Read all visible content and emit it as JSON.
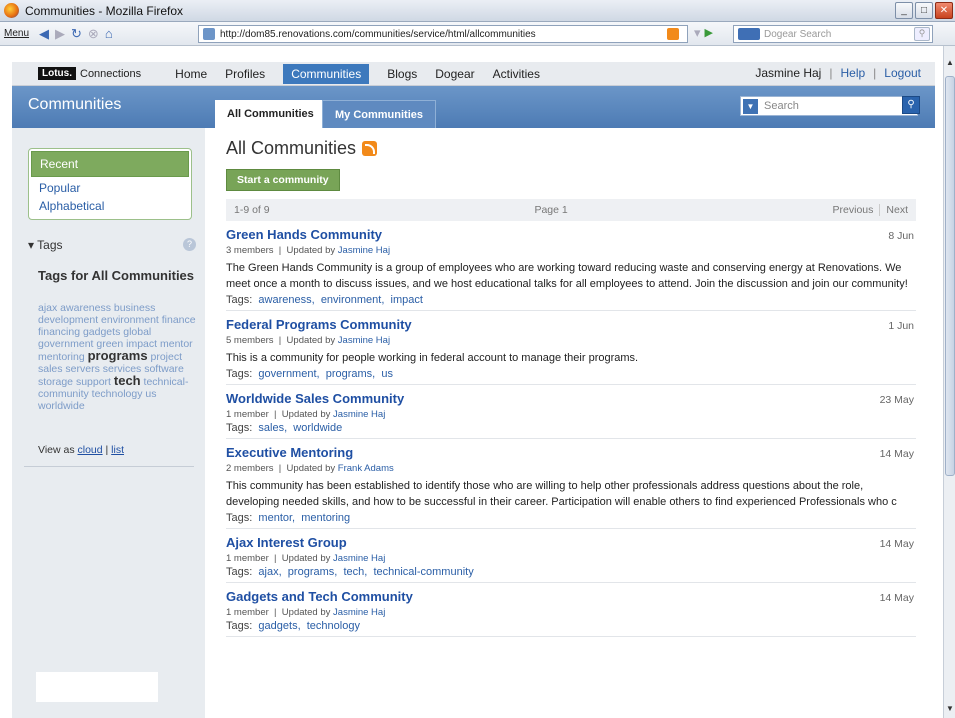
{
  "window": {
    "title": "Communities - Mozilla Firefox"
  },
  "browser": {
    "menu_label": "Menu",
    "url": "http://dom85.renovations.com/communities/service/html/allcommunities",
    "search_placeholder": "Dogear Search"
  },
  "app": {
    "logo_brand": "Lotus.",
    "logo_product": "Connections",
    "nav": [
      "Home",
      "Profiles",
      "Communities",
      "Blogs",
      "Dogear",
      "Activities"
    ],
    "user": "Jasmine Haj",
    "help": "Help",
    "logout": "Logout"
  },
  "header": {
    "page_title": "Communities",
    "tabs": [
      "All Communities",
      "My Communities"
    ],
    "search_placeholder": "Search"
  },
  "sidebar": {
    "filters": [
      "Recent",
      "Popular",
      "Alphabetical"
    ],
    "tags_heading": "Tags",
    "tags_all_heading": "Tags for All Communities",
    "tag_cloud_before": "ajax awareness business development environment finance financing gadgets global government green impact mentor mentoring ",
    "tag_big_1": "programs",
    "tag_cloud_mid": " project sales servers services software storage support ",
    "tag_big_2": "tech",
    "tag_cloud_after": " technical-community technology us worldwide",
    "view_as_label": "View as",
    "view_cloud": "cloud",
    "view_list": "list"
  },
  "main": {
    "heading": "All Communities",
    "start_button": "Start a community",
    "pager_count": "1-9 of 9",
    "pager_page": "Page 1",
    "pager_prev": "Previous",
    "pager_next": "Next",
    "tags_label": "Tags:",
    "communities": [
      {
        "name": "Green Hands Community",
        "date": "8 Jun",
        "members": "3 members",
        "updated_by_label": "Updated by",
        "updated_by": "Jasmine Haj",
        "description": "The Green Hands Community is a group of employees who are working toward reducing waste and conserving energy at Renovations. We meet once a month to discuss issues, and we host educational talks for all employees to attend. Join the discussion and join our community!",
        "tags": [
          "awareness,",
          "environment,",
          "impact"
        ]
      },
      {
        "name": "Federal Programs Community",
        "date": "1 Jun",
        "members": "5 members",
        "updated_by_label": "Updated by",
        "updated_by": "Jasmine Haj",
        "description": "This is a community for people working in federal account to manage their programs.",
        "tags": [
          "government,",
          "programs,",
          "us"
        ]
      },
      {
        "name": "Worldwide Sales Community",
        "date": "23 May",
        "members": "1 member",
        "updated_by_label": "Updated by",
        "updated_by": "Jasmine Haj",
        "description": "",
        "tags": [
          "sales,",
          "worldwide"
        ]
      },
      {
        "name": "Executive Mentoring",
        "date": "14 May",
        "members": "2 members",
        "updated_by_label": "Updated by",
        "updated_by": "Frank Adams",
        "description": "This community has been established to identify those who are willing to help other professionals address questions about the role, developing needed skills, and how to be successful in their career. Participation will enable others to find experienced Professionals who c",
        "tags": [
          "mentor,",
          "mentoring"
        ]
      },
      {
        "name": "Ajax Interest Group",
        "date": "14 May",
        "members": "1 member",
        "updated_by_label": "Updated by",
        "updated_by": "Jasmine Haj",
        "description": "",
        "tags": [
          "ajax,",
          "programs,",
          "tech,",
          "technical-community"
        ]
      },
      {
        "name": "Gadgets and Tech Community",
        "date": "14 May",
        "members": "1 member",
        "updated_by_label": "Updated by",
        "updated_by": "Jasmine Haj",
        "description": "",
        "tags": [
          "gadgets,",
          "technology"
        ]
      }
    ]
  }
}
